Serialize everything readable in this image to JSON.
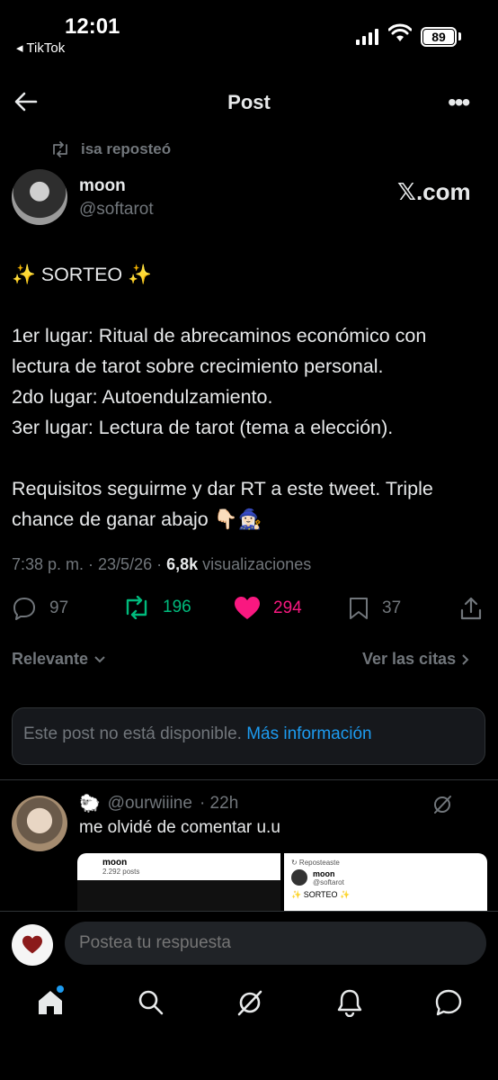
{
  "status_bar": {
    "time": "12:01",
    "back_app": "◂ TikTok",
    "battery": "89"
  },
  "header": {
    "title": "Post"
  },
  "repost_note": "isa reposteó",
  "author": {
    "name": "moon",
    "handle": "@softarot",
    "source_badge": "𝕏.com"
  },
  "post": {
    "text": "✨ SORTEO ✨\n\n1er lugar: Ritual de abrecaminos económico con lectura de tarot sobre crecimiento personal.\n2do lugar: Autoendulzamiento.\n3er lugar: Lectura de tarot (tema a elección).\n\nRequisitos seguirme y dar RT a este tweet. Triple chance de ganar abajo 👇🏻🧙🏻‍♀️",
    "time": "7:38 p. m. · 23/5/26 · ",
    "views_count": "6,8k",
    "views_label": " visualizaciones"
  },
  "actions": {
    "replies": "97",
    "reposts": "196",
    "likes": "294",
    "bookmarks": "37"
  },
  "colors": {
    "repost": "#00ba7c",
    "like": "#f91880",
    "link": "#1d9bf0"
  },
  "filters": {
    "left": "Relevante",
    "right": "Ver las citas"
  },
  "unavailable": {
    "text": "Este post no está disponible. ",
    "link": "Más información"
  },
  "reply": {
    "emoji": "🐑",
    "handle": "@ourwiiine",
    "time": "· 22h",
    "text": "me olvidé de comentar u.u",
    "thumb1_name": "moon",
    "thumb1_sub": "2.292 posts",
    "thumb2_label": "↻ Reposteaste",
    "thumb2_name": "moon",
    "thumb2_handle": "@softarot",
    "thumb2_text": "✨ SORTEO ✨"
  },
  "composer": {
    "placeholder": "Postea tu respuesta"
  },
  "icons": [
    "back-arrow-icon",
    "more-icon",
    "repost-icon",
    "reply-icon",
    "like-icon",
    "bookmark-icon",
    "share-icon",
    "grok-icon",
    "home-icon",
    "search-icon",
    "notifications-icon",
    "messages-icon"
  ]
}
